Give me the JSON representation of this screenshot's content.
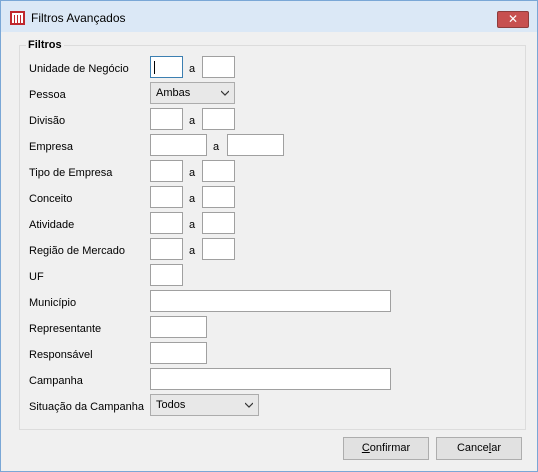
{
  "window": {
    "title": "Filtros Avançados",
    "close_glyph": "✕"
  },
  "filters": {
    "group_title": "Filtros",
    "separator": "a",
    "unidade_negocio": {
      "label": "Unidade de Negócio",
      "from": "",
      "to": ""
    },
    "pessoa": {
      "label": "Pessoa",
      "value": "Ambas"
    },
    "divisao": {
      "label": "Divisão",
      "from": "",
      "to": ""
    },
    "empresa": {
      "label": "Empresa",
      "from": "",
      "to": ""
    },
    "tipo_empresa": {
      "label": "Tipo de Empresa",
      "from": "",
      "to": ""
    },
    "conceito": {
      "label": "Conceito",
      "from": "",
      "to": ""
    },
    "atividade": {
      "label": "Atividade",
      "from": "",
      "to": ""
    },
    "regiao_mercado": {
      "label": "Região de Mercado",
      "from": "",
      "to": ""
    },
    "uf": {
      "label": "UF",
      "value": ""
    },
    "municipio": {
      "label": "Município",
      "value": ""
    },
    "representante": {
      "label": "Representante",
      "value": ""
    },
    "responsavel": {
      "label": "Responsável",
      "value": ""
    },
    "campanha": {
      "label": "Campanha",
      "value": ""
    },
    "situacao_campanha": {
      "label": "Situação da Campanha",
      "value": "Todos"
    }
  },
  "buttons": {
    "confirmar": {
      "mnemonic": "C",
      "rest": "onfirmar"
    },
    "cancelar": {
      "prefix": "Cance",
      "mnemonic": "l",
      "rest": "ar"
    }
  },
  "icons": {
    "app": "app-logo-icon",
    "dropdown": "chevron-down-icon"
  },
  "colors": {
    "titlebar": "#dbe8f6",
    "close": "#c75050",
    "focus": "#3c7fb1"
  }
}
